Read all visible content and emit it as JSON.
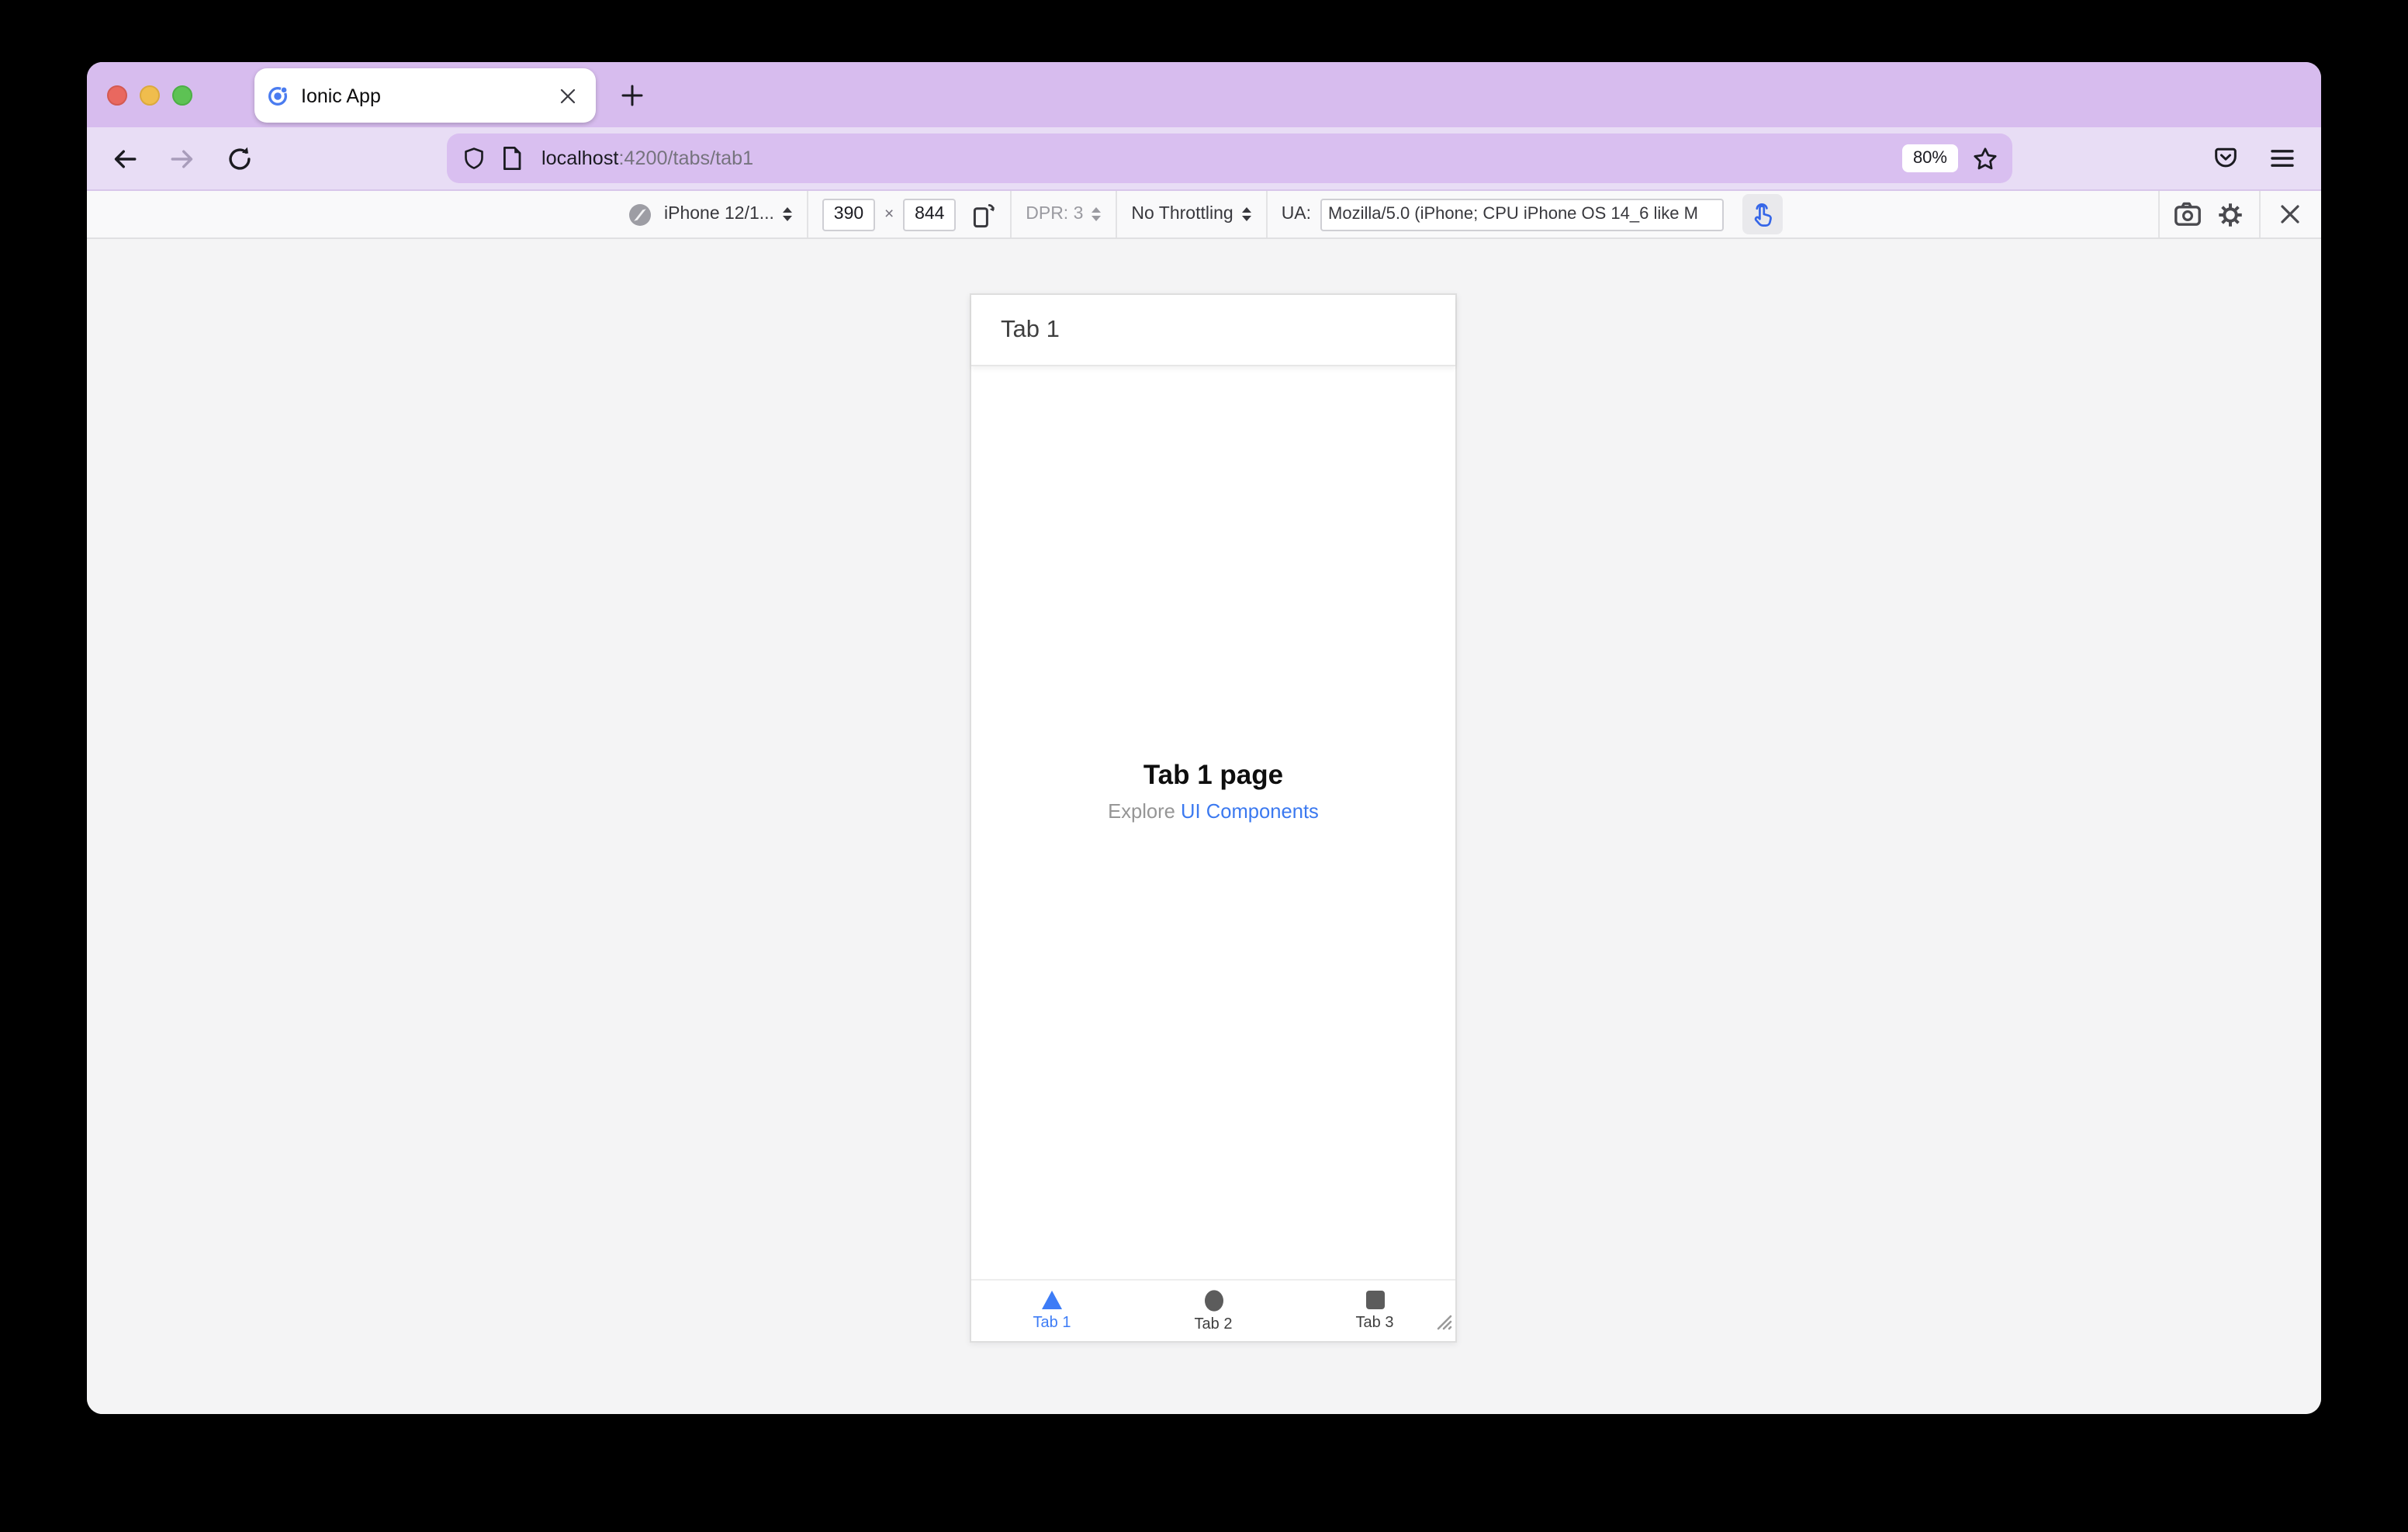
{
  "window": {
    "controls": [
      "close",
      "minimize",
      "zoom"
    ]
  },
  "browser": {
    "tab": {
      "title": "Ionic App"
    },
    "newtab": "+",
    "url": {
      "host": "localhost",
      "path": ":4200/tabs/tab1"
    },
    "zoom_badge": "80%"
  },
  "rdm": {
    "device": "iPhone 12/1...",
    "viewport_width": "390",
    "dim_separator": "×",
    "viewport_height": "844",
    "dpr": "DPR: 3",
    "throttling": "No Throttling",
    "ua_label": "UA:",
    "ua_value": "Mozilla/5.0 (iPhone; CPU iPhone OS 14_6 like M"
  },
  "app": {
    "header_title": "Tab 1",
    "page_title": "Tab 1 page",
    "subtitle_prefix": "Explore ",
    "subtitle_link": "UI Components",
    "tabs": [
      {
        "label": "Tab 1",
        "active": true
      },
      {
        "label": "Tab 2",
        "active": false
      },
      {
        "label": "Tab 3",
        "active": false
      }
    ]
  },
  "icons": {
    "tab_favicon": "ionic-logo-icon",
    "urlbar": [
      "shield-icon",
      "page-icon",
      "star-icon"
    ],
    "toolbar": [
      "back-icon",
      "forward-icon",
      "reload-icon",
      "pocket-icon",
      "hamburger-menu-icon"
    ],
    "rdm": [
      "compass-icon",
      "stepper-icon",
      "rotate-viewport-icon",
      "touch-simulation-icon",
      "screenshot-camera-icon",
      "settings-gear-icon",
      "close-icon"
    ],
    "app_tabs": [
      "triangle-icon",
      "ellipse-icon",
      "square-icon"
    ]
  },
  "colors": {
    "titlebar": "#d7bcee",
    "toolbar": "#e8ddf5",
    "urlbar": "#d9bff0",
    "rdm_bg": "#f9f9fa",
    "content_bg": "#f4f4f5",
    "accent_blue": "#3d7cf6",
    "link_blue": "#3b79f0",
    "traffic_red": "#e9685f",
    "traffic_yellow": "#f0bd4d",
    "traffic_green": "#5dc254"
  }
}
